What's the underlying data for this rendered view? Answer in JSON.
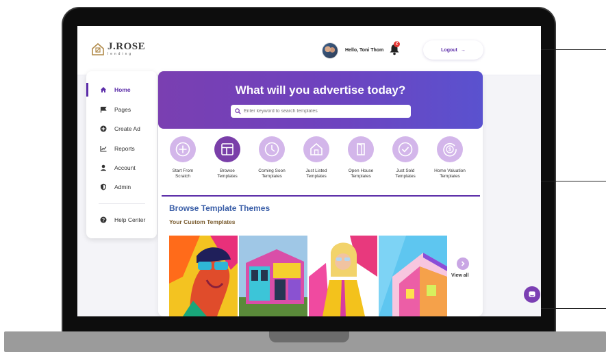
{
  "brand": {
    "name": "J.ROSE",
    "tagline": "lending"
  },
  "header": {
    "greeting": "Hello, Toni Thom",
    "notification_count": "2",
    "logout_label": "Logout",
    "logout_arrow": "→"
  },
  "sidebar": {
    "items": [
      {
        "label": "Home",
        "icon": "home-icon"
      },
      {
        "label": "Pages",
        "icon": "flag-icon"
      },
      {
        "label": "Create Ad",
        "icon": "plus-circle-icon"
      },
      {
        "label": "Reports",
        "icon": "chart-icon"
      },
      {
        "label": "Account",
        "icon": "user-icon"
      },
      {
        "label": "Admin",
        "icon": "shield-icon"
      }
    ],
    "help": {
      "label": "Help Center",
      "icon": "question-icon"
    }
  },
  "hero": {
    "title": "What will you advertise today?",
    "search_placeholder": "Enter keyword to search templates"
  },
  "templates": [
    {
      "line1": "Start From",
      "line2": "Scratch",
      "icon": "plus-icon"
    },
    {
      "line1": "Browse",
      "line2": "Templates",
      "icon": "layout-icon"
    },
    {
      "line1": "Coming Soon",
      "line2": "Templates",
      "icon": "clock-icon"
    },
    {
      "line1": "Just Listed",
      "line2": "Templates",
      "icon": "house-icon"
    },
    {
      "line1": "Open House",
      "line2": "Templates",
      "icon": "door-icon"
    },
    {
      "line1": "Just Sold",
      "line2": "Templates",
      "icon": "check-icon"
    },
    {
      "line1": "Home Valuation",
      "line2": "Templates",
      "icon": "valuation-icon"
    }
  ],
  "browse": {
    "title": "Browse Template Themes",
    "subtitle": "Your Custom Templates",
    "view_all": "View all"
  },
  "colors": {
    "accent": "#5b2ca8",
    "hero_start": "#7a3fb1",
    "hero_end": "#5a52cf",
    "tile": "#d3b6ea"
  }
}
